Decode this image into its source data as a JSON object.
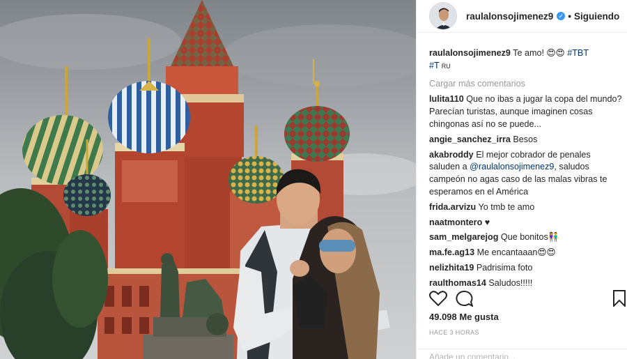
{
  "post": {
    "username": "raulalonsojimenez9",
    "follow_status": "Siguiendo",
    "separator": "•",
    "caption_text": "Te amo! 😍😍",
    "caption_tags": [
      "#TBT",
      "#T"
    ],
    "caption_tail": "RU",
    "load_more": "Cargar más comentarios",
    "comments": [
      {
        "user": "lulita110",
        "text": "Que no ibas a jugar la copa del mundo? Parecían turistas, aunque imaginen cosas chingonas así no se puede..."
      },
      {
        "user": "angie_sanchez_irra",
        "text": "Besos"
      },
      {
        "user": "akabroddy",
        "text": "El mejor cobrador de penales saluden a",
        "mention": "@raulalonsojimenez9",
        "text2": ", saludos campeón no agas caso de las malas vibras te esperamos en el América"
      },
      {
        "user": "frida.arvizu",
        "text": "Yo tmb te amo"
      },
      {
        "user": "naatmontero",
        "text": "♥"
      },
      {
        "user": "sam_melgarejog",
        "text": "Que bonitos👫"
      },
      {
        "user": "ma.fe.ag13",
        "text": "Me encantaaan😍😍"
      },
      {
        "user": "nelizhita19",
        "text": "Padrisima foto"
      },
      {
        "user": "raulthomas14",
        "text": "Saludos!!!!!"
      }
    ],
    "likes": "49.098 Me gusta",
    "time": "HACE 3 HORAS",
    "add_comment_placeholder": "Añade un comentario..."
  },
  "icons": {
    "like": "heart-outline-icon",
    "comment": "speech-bubble-icon",
    "save": "bookmark-icon",
    "verified": "verified-badge-icon"
  },
  "colors": {
    "link": "#003569",
    "muted": "#999999",
    "verified": "#3897f0"
  }
}
